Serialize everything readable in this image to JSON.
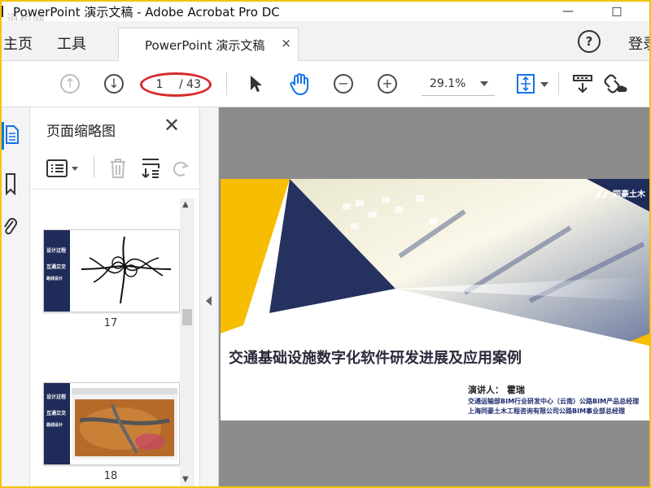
{
  "app": {
    "title": "PowerPoint 演示文稿 - Adobe Acrobat Pro DC",
    "watermark": "道桥网",
    "window_controls": {
      "minimize": "—",
      "maximize": "□"
    }
  },
  "tabs": {
    "home": "主页",
    "tools": "工具",
    "document": "PowerPoint 演示文稿",
    "close_glyph": "×",
    "help_glyph": "?",
    "login": "登录"
  },
  "toolbar": {
    "page_current": "1",
    "page_total": "/ 43",
    "zoom": "29.1%",
    "icons": [
      "arrow-up-icon",
      "arrow-down-icon",
      "cursor-icon",
      "hand-icon",
      "zoom-out-icon",
      "zoom-in-icon",
      "fit-page-icon",
      "scroll-mode-icon",
      "link-icon"
    ]
  },
  "panel": {
    "title": "页面缩略图",
    "close_glyph": "✕",
    "thumbnails": [
      {
        "page": "17",
        "side_lines": [
          "设计过程",
          "互通立交",
          "路线设计"
        ]
      },
      {
        "page": "18",
        "side_lines": [
          "设计过程",
          "互通立交",
          "路线设计"
        ]
      }
    ]
  },
  "slide": {
    "title": "交通基础设施数字化软件研发进展及应用案例",
    "presenter": "演讲人：  霍瑞",
    "line1": "交通运输部BIM行业研发中心（云南）公路BIM产品总经理",
    "line2": "上海同豪土木工程咨询有限公司公路BIM事业部总经理",
    "logo": "同豪土木"
  },
  "colors": {
    "highlight": "#d62b2b",
    "accent_blue": "#1473e6",
    "slide_yellow": "#f7bd00",
    "slide_navy": "#1f2c59",
    "frame": "#f2c400"
  }
}
